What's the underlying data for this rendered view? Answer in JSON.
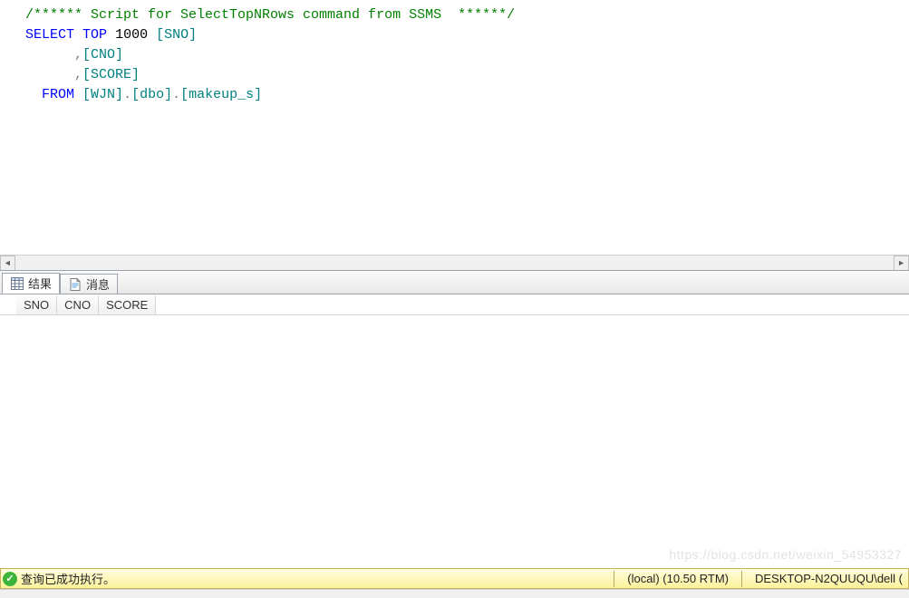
{
  "editor": {
    "lines": [
      {
        "segments": [
          {
            "cls": "c-comment",
            "t": "/****** Script for SelectTopNRows command from SSMS  ******/"
          }
        ]
      },
      {
        "segments": [
          {
            "cls": "c-keyword",
            "t": "SELECT"
          },
          {
            "cls": "",
            "t": " "
          },
          {
            "cls": "c-keyword",
            "t": "TOP"
          },
          {
            "cls": "",
            "t": " "
          },
          {
            "cls": "c-number",
            "t": "1000"
          },
          {
            "cls": "",
            "t": " "
          },
          {
            "cls": "c-ident",
            "t": "[SNO]"
          }
        ]
      },
      {
        "segments": [
          {
            "cls": "",
            "t": "      "
          },
          {
            "cls": "c-gray",
            "t": ","
          },
          {
            "cls": "c-ident",
            "t": "[CNO]"
          }
        ]
      },
      {
        "segments": [
          {
            "cls": "",
            "t": "      "
          },
          {
            "cls": "c-gray",
            "t": ","
          },
          {
            "cls": "c-ident",
            "t": "[SCORE]"
          }
        ]
      },
      {
        "segments": [
          {
            "cls": "",
            "t": "  "
          },
          {
            "cls": "c-keyword",
            "t": "FROM"
          },
          {
            "cls": "",
            "t": " "
          },
          {
            "cls": "c-ident",
            "t": "[WJN]"
          },
          {
            "cls": "c-gray",
            "t": "."
          },
          {
            "cls": "c-ident",
            "t": "[dbo]"
          },
          {
            "cls": "c-gray",
            "t": "."
          },
          {
            "cls": "c-ident",
            "t": "[makeup_s]"
          }
        ]
      }
    ]
  },
  "tabs": {
    "results_label": "结果",
    "messages_label": "消息"
  },
  "grid": {
    "columns": [
      "SNO",
      "CNO",
      "SCORE"
    ]
  },
  "status": {
    "text": "查询已成功执行。",
    "server": "(local) (10.50 RTM)",
    "user": "DESKTOP-N2QUUQU\\dell ("
  },
  "watermark": "https://blog.csdn.net/weixin_54953327"
}
